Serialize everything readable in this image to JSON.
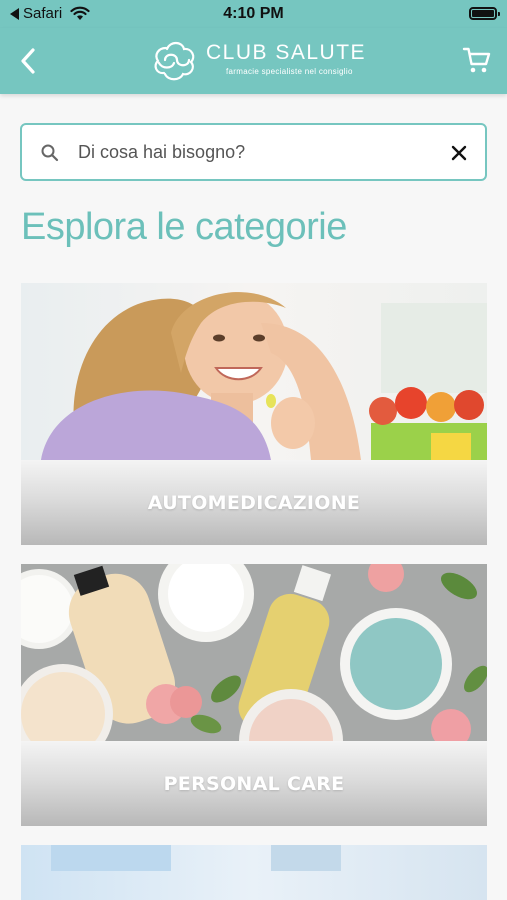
{
  "status_bar": {
    "back_app": "Safari",
    "time": "4:10 PM"
  },
  "header": {
    "brand_title": "CLUB SALUTE",
    "brand_tagline": "farmacie specialiste nel consiglio",
    "back_icon": "chevron-left-icon",
    "cart_icon": "cart-icon"
  },
  "search": {
    "placeholder": "Di cosa hai bisogno?",
    "value": ""
  },
  "section": {
    "title": "Esplora le categorie"
  },
  "categories": [
    {
      "label": "AUTOMEDICAZIONE"
    },
    {
      "label": "PERSONAL CARE"
    }
  ],
  "colors": {
    "accent": "#76c6c0",
    "title": "#6cc0ba",
    "background": "#f7f7f7"
  }
}
